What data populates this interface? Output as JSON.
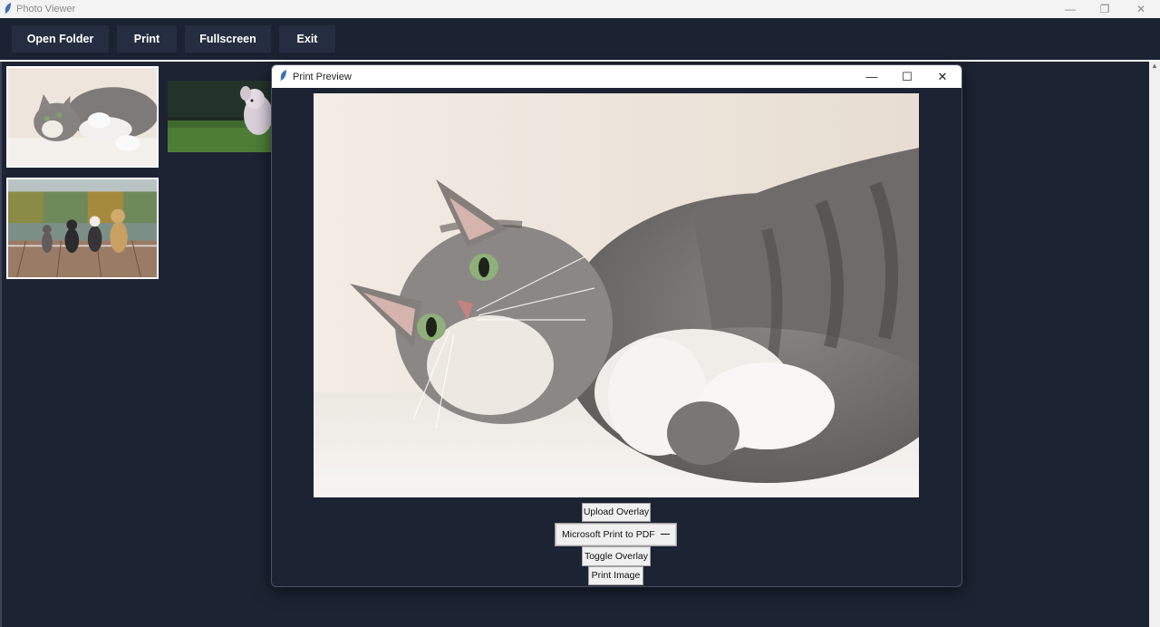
{
  "window": {
    "title": "Photo Viewer",
    "controls": {
      "minimize": "—",
      "restore": "❐",
      "close": "✕"
    }
  },
  "toolbar": {
    "buttons": [
      {
        "label": "Open Folder"
      },
      {
        "label": "Print"
      },
      {
        "label": "Fullscreen"
      },
      {
        "label": "Exit"
      }
    ]
  },
  "thumbnails": [
    {
      "subject": "cat-lying"
    },
    {
      "subject": "dog-on-grass"
    },
    {
      "subject": "four-dogs-on-dock"
    }
  ],
  "dialog": {
    "title": "Print Preview",
    "controls": {
      "minimize": "—",
      "maximize": "☐",
      "close": "✕"
    },
    "upload_overlay_label": "Upload Overlay",
    "printer": {
      "selected": "Microsoft Print to PDF",
      "indicator": "⎯⎯"
    },
    "toggle_overlay_label": "Toggle Overlay",
    "print_image_label": "Print Image"
  },
  "colors": {
    "background": "#1c2333",
    "toolbar": "#1b2232",
    "button": "#252d40",
    "button_text": "#ffffff"
  }
}
